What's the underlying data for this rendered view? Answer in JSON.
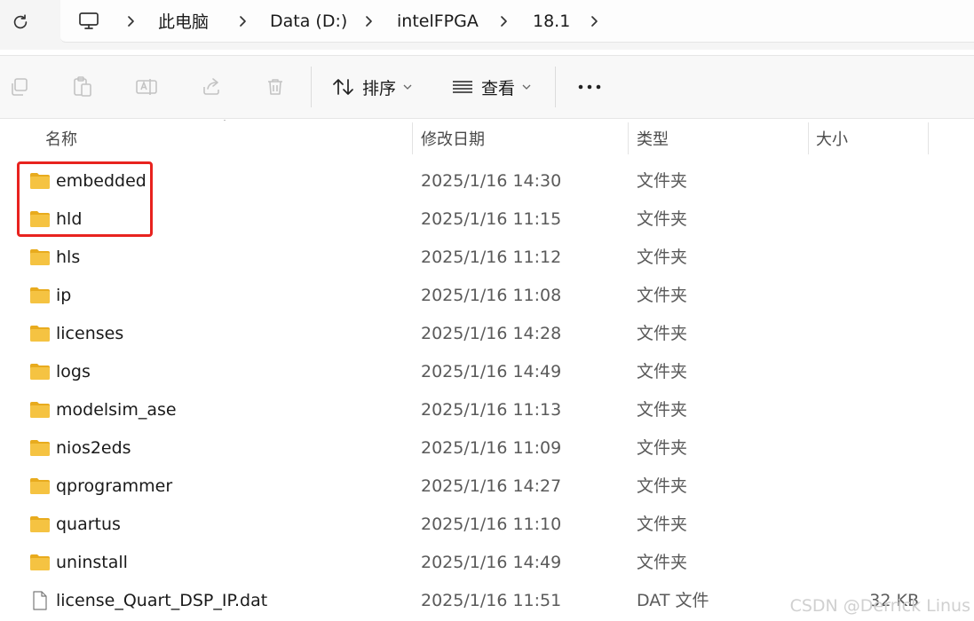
{
  "address_bar": {
    "breadcrumbs": [
      {
        "label": "此电脑"
      },
      {
        "label": "Data (D:)"
      },
      {
        "label": "intelFPGA"
      },
      {
        "label": "18.1"
      }
    ]
  },
  "toolbar": {
    "sort_label": "排序",
    "view_label": "查看",
    "more_label": "•••"
  },
  "columns": {
    "name": "名称",
    "date": "修改日期",
    "type": "类型",
    "size": "大小"
  },
  "files": [
    {
      "name": "embedded",
      "date": "2025/1/16 14:30",
      "type": "文件夹",
      "size": "",
      "kind": "folder"
    },
    {
      "name": "hld",
      "date": "2025/1/16 11:15",
      "type": "文件夹",
      "size": "",
      "kind": "folder"
    },
    {
      "name": "hls",
      "date": "2025/1/16 11:12",
      "type": "文件夹",
      "size": "",
      "kind": "folder"
    },
    {
      "name": "ip",
      "date": "2025/1/16 11:08",
      "type": "文件夹",
      "size": "",
      "kind": "folder"
    },
    {
      "name": "licenses",
      "date": "2025/1/16 14:28",
      "type": "文件夹",
      "size": "",
      "kind": "folder"
    },
    {
      "name": "logs",
      "date": "2025/1/16 14:49",
      "type": "文件夹",
      "size": "",
      "kind": "folder"
    },
    {
      "name": "modelsim_ase",
      "date": "2025/1/16 11:13",
      "type": "文件夹",
      "size": "",
      "kind": "folder"
    },
    {
      "name": "nios2eds",
      "date": "2025/1/16 11:09",
      "type": "文件夹",
      "size": "",
      "kind": "folder"
    },
    {
      "name": "qprogrammer",
      "date": "2025/1/16 14:27",
      "type": "文件夹",
      "size": "",
      "kind": "folder"
    },
    {
      "name": "quartus",
      "date": "2025/1/16 11:10",
      "type": "文件夹",
      "size": "",
      "kind": "folder"
    },
    {
      "name": "uninstall",
      "date": "2025/1/16 14:49",
      "type": "文件夹",
      "size": "",
      "kind": "folder"
    },
    {
      "name": "license_Quart_DSP_IP.dat",
      "date": "2025/1/16 11:51",
      "type": "DAT 文件",
      "size": "32 KB",
      "kind": "file"
    }
  ],
  "watermark": "CSDN @Derrick Linus",
  "colors": {
    "folder": "#f5c342",
    "folder_dark": "#e8ab1e",
    "highlight": "#e8231f"
  }
}
